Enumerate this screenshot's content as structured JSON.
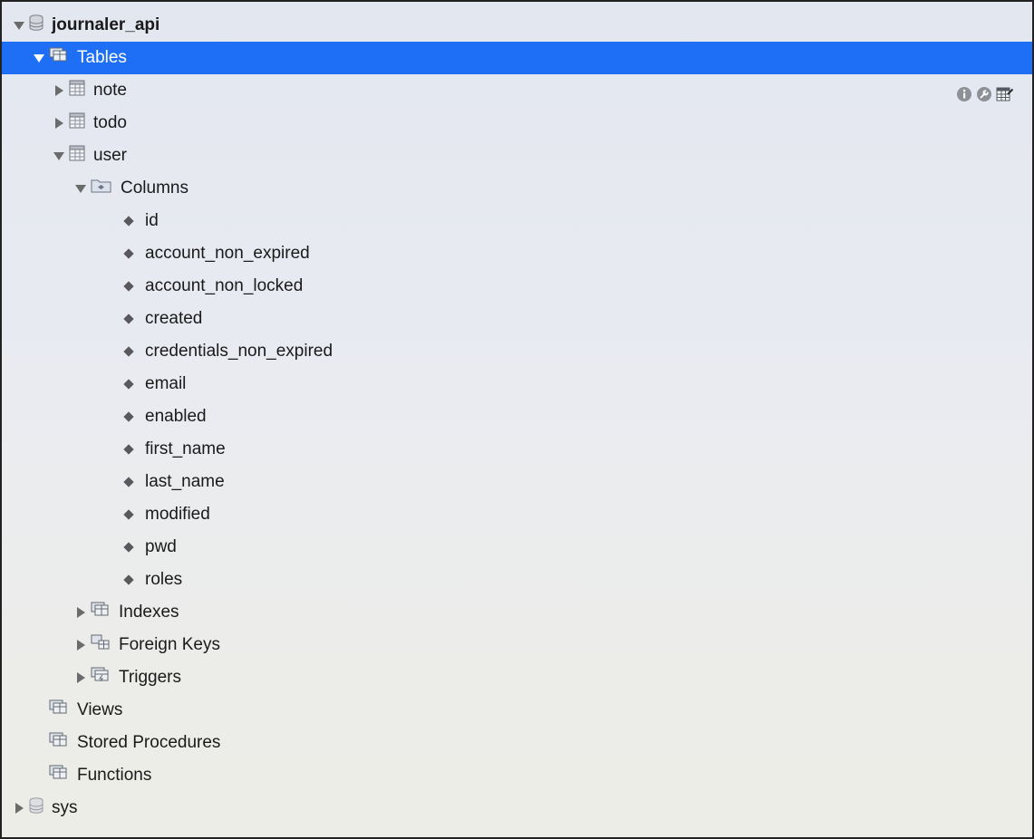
{
  "tree": {
    "schema_main": {
      "name": "journaler_api"
    },
    "tables_group": {
      "label": "Tables"
    },
    "tables": [
      {
        "name": "note"
      },
      {
        "name": "todo"
      },
      {
        "name": "user"
      }
    ],
    "columns_group": {
      "label": "Columns"
    },
    "columns": [
      "id",
      "account_non_expired",
      "account_non_locked",
      "created",
      "credentials_non_expired",
      "email",
      "enabled",
      "first_name",
      "last_name",
      "modified",
      "pwd",
      "roles"
    ],
    "indexes_group": {
      "label": "Indexes"
    },
    "foreign_keys_group": {
      "label": "Foreign Keys"
    },
    "triggers_group": {
      "label": "Triggers"
    },
    "views_group": {
      "label": "Views"
    },
    "procedures_group": {
      "label": "Stored Procedures"
    },
    "functions_group": {
      "label": "Functions"
    },
    "schema_sys": {
      "name": "sys"
    }
  },
  "row_actions": [
    {
      "icon": "info-icon"
    },
    {
      "icon": "wrench-icon"
    },
    {
      "icon": "table-edit-icon"
    }
  ],
  "colors": {
    "selection": "#1e6ff5",
    "background": "#e6e9f0",
    "text": "#1a1a1a"
  }
}
